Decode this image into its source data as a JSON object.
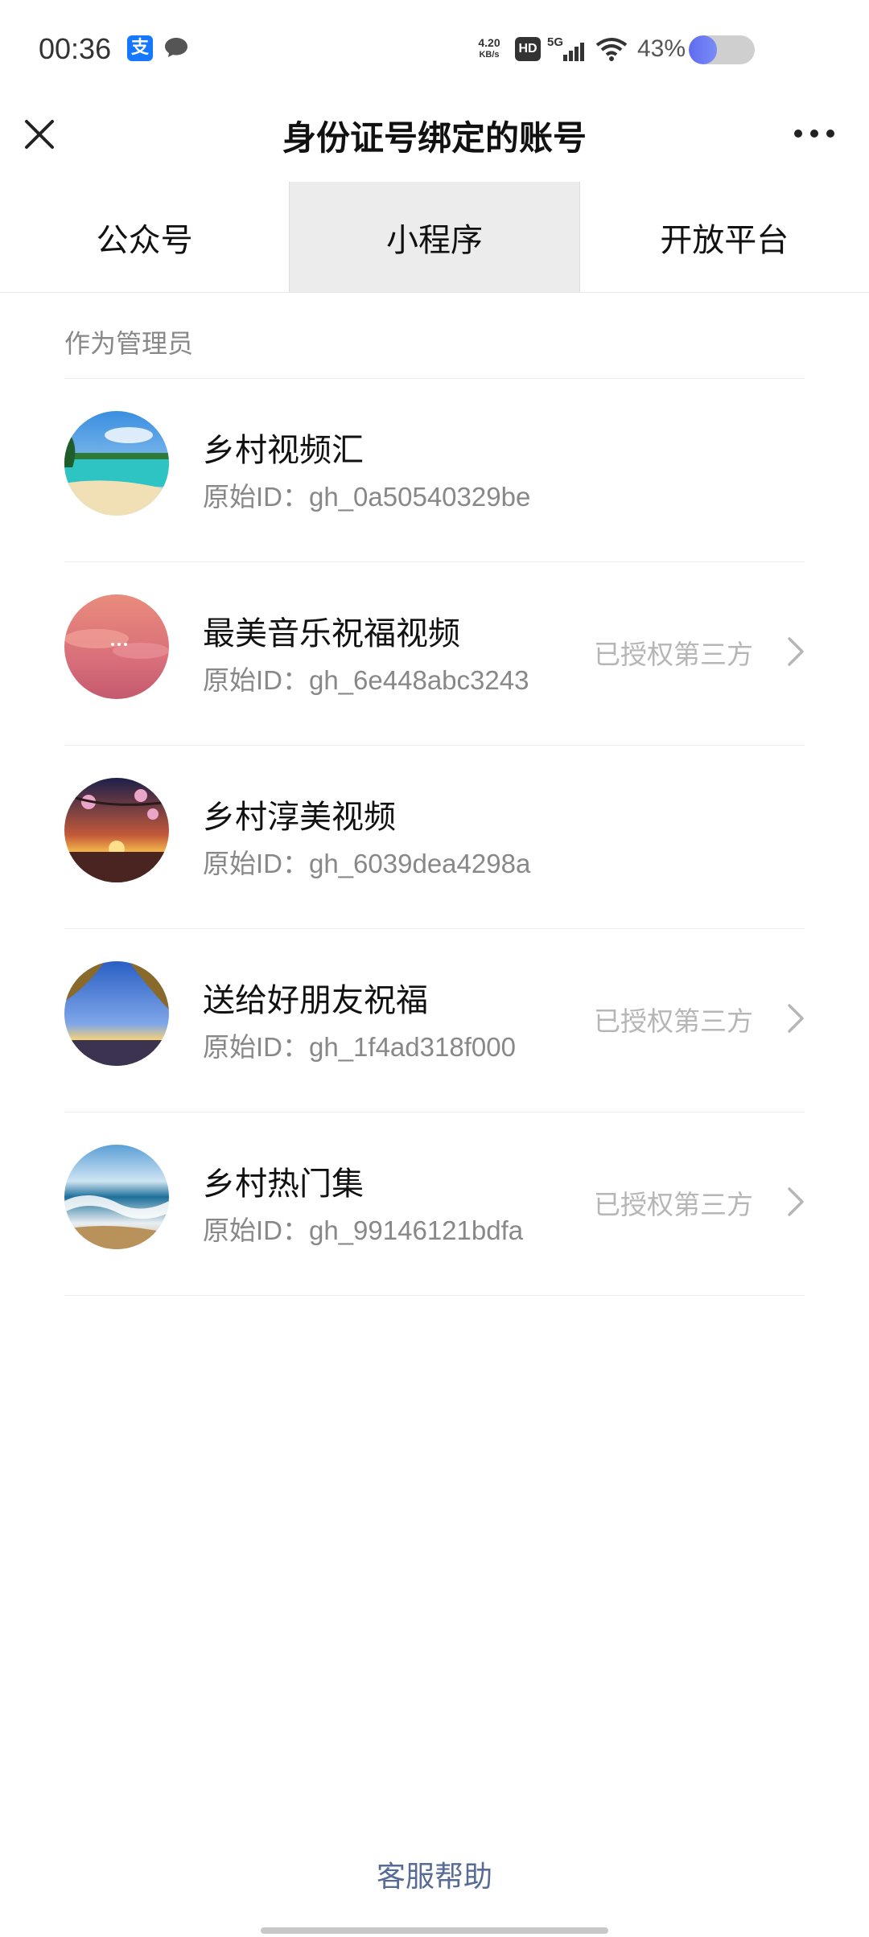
{
  "status_bar": {
    "time": "00:36",
    "alipay_glyph": "支",
    "net_speed_value": "4.20",
    "net_speed_unit": "KB/s",
    "hd_badge": "HD",
    "network": "5G",
    "battery_percent_text": "43%",
    "battery_level": 0.43,
    "icons": [
      "alipay-icon",
      "chat-icon",
      "hd-icon",
      "signal-icon",
      "wifi-icon",
      "battery-icon"
    ]
  },
  "header": {
    "title": "身份证号绑定的账号",
    "close_icon": "close-icon",
    "more_icon": "more-icon"
  },
  "tabs": [
    {
      "label": "公众号",
      "active": false
    },
    {
      "label": "小程序",
      "active": true
    },
    {
      "label": "开放平台",
      "active": false
    }
  ],
  "section": {
    "label": "作为管理员"
  },
  "accounts": [
    {
      "name": "乡村视频汇",
      "id": "原始ID：gh_0a50540329be",
      "status": "",
      "avatar": "beach-avatar"
    },
    {
      "name": "最美音乐祝福视频",
      "id": "原始ID：gh_6e448abc3243",
      "status": "已授权第三方",
      "avatar": "pink-sky-avatar"
    },
    {
      "name": "乡村淳美视频",
      "id": "原始ID：gh_6039dea4298a",
      "status": "",
      "avatar": "sunset-blossom-avatar"
    },
    {
      "name": "送给好朋友祝福",
      "id": "原始ID：gh_1f4ad318f000",
      "status": "已授权第三方",
      "avatar": "tree-sunset-avatar"
    },
    {
      "name": "乡村热门集",
      "id": "原始ID：gh_99146121bdfa",
      "status": "已授权第三方",
      "avatar": "ocean-wave-avatar"
    }
  ],
  "footer": {
    "help_label": "客服帮助"
  },
  "colors": {
    "link": "#576b95",
    "active_tab_bg": "#ececec",
    "battery_fill": "#5f6cf0"
  }
}
